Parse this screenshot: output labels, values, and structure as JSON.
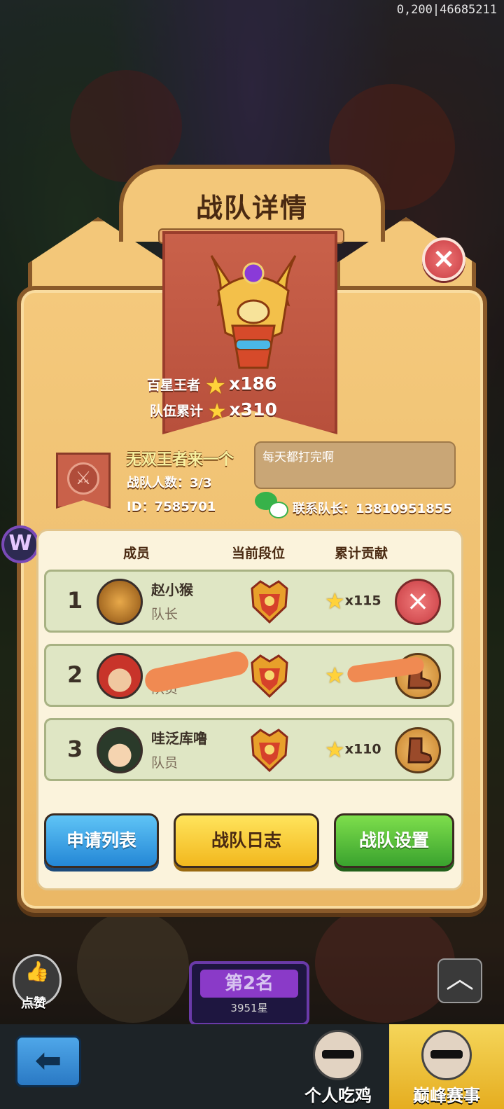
{
  "status": {
    "id_readout": "0,200|46685211"
  },
  "modal": {
    "title": "战队详情",
    "stats": [
      {
        "label": "百星王者",
        "value": "x186"
      },
      {
        "label": "队伍累计",
        "value": "x310"
      }
    ],
    "team": {
      "name": "无双王者来一个",
      "count": "战队人数：3/3",
      "id": "ID：7585701",
      "motto": "每天都打完啊",
      "contact": "联系队长：13810951855"
    },
    "columns": {
      "member": "成员",
      "rank": "当前段位",
      "contribution": "累计贡献"
    },
    "members": [
      {
        "index": "1",
        "name": "赵小猴",
        "role": "队长",
        "contribution": "x115",
        "action": "close-icon"
      },
      {
        "index": "2",
        "name": "",
        "role": "队员",
        "contribution": "",
        "action": "boot-icon"
      },
      {
        "index": "3",
        "name": "哇泛库噜",
        "role": "队员",
        "contribution": "x110",
        "action": "boot-icon"
      }
    ],
    "buttons": {
      "apply_list": "申请列表",
      "team_log": "战队日志",
      "team_settings": "战队设置"
    },
    "close_icon": "×"
  },
  "bottom": {
    "like_label": "点赞",
    "rank_label": "第2名",
    "rank_stars": "3951星",
    "tabs": [
      "个人吃鸡",
      "巅峰赛事"
    ]
  },
  "colors": {
    "accent_blue": "#2487d6",
    "accent_yellow": "#f2b81e",
    "accent_green": "#3aa32e",
    "panel": "#f4c97c",
    "close_red": "#c83c42"
  }
}
